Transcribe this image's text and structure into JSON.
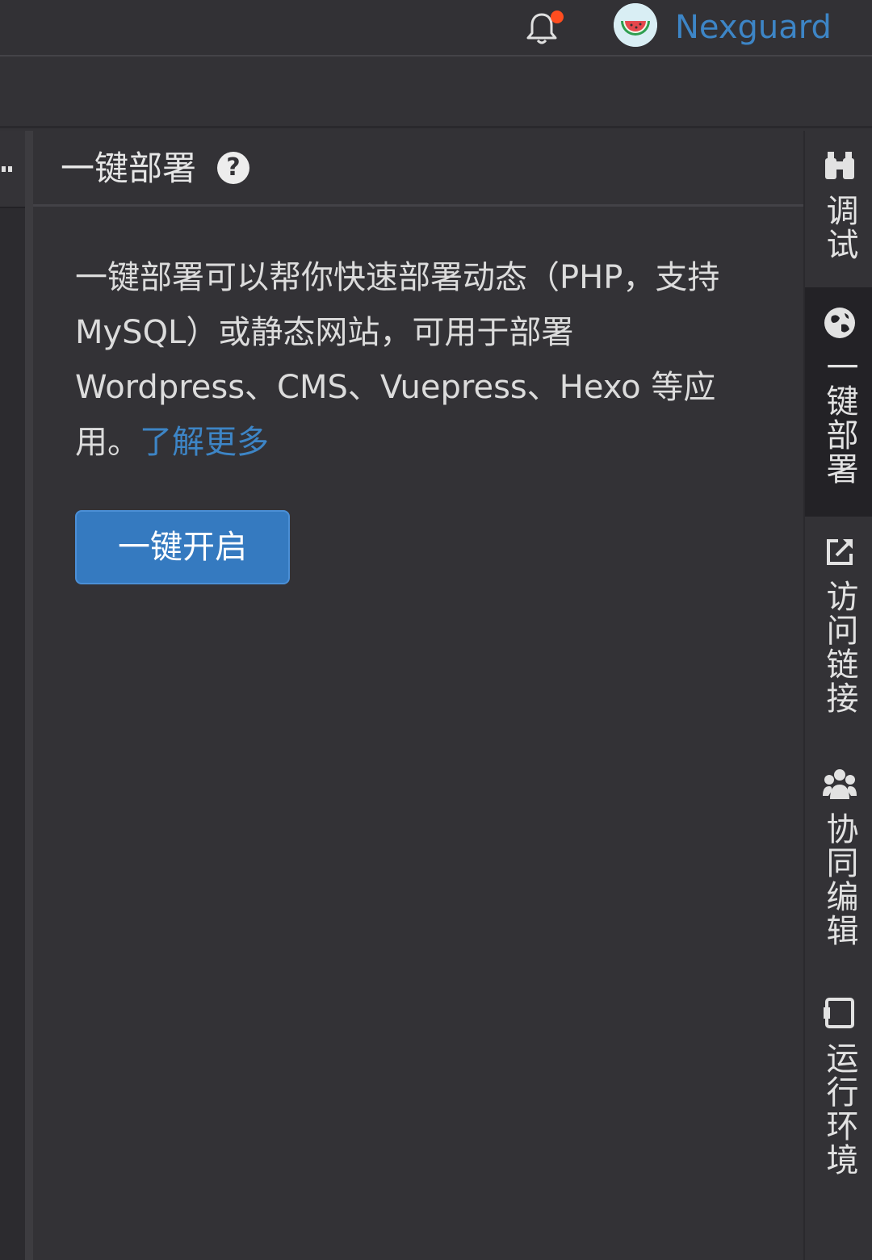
{
  "header": {
    "username": "Nexguard",
    "notifications_unread": true
  },
  "panel": {
    "title": "一键部署",
    "description": "一键部署可以帮你快速部署动态（PHP，支持 MySQL）或静态网站，可用于部署 Wordpress、CMS、Vuepress、Hexo 等应用。",
    "learn_more": "了解更多",
    "enable_button": "一键开启"
  },
  "right_tabs": [
    {
      "label": "调试",
      "icon": "binoculars-icon",
      "active": false
    },
    {
      "label": "一键部署",
      "icon": "globe-icon",
      "active": true
    },
    {
      "label": "访问链接",
      "icon": "external-link-icon",
      "active": false
    },
    {
      "label": "协同编辑",
      "icon": "users-icon",
      "active": false
    },
    {
      "label": "运行环境",
      "icon": "monitor-icon",
      "active": false
    }
  ],
  "colors": {
    "accent": "#3d85c6",
    "button": "#357ac0",
    "background": "#333236",
    "notification_dot": "#ff4d1f"
  }
}
